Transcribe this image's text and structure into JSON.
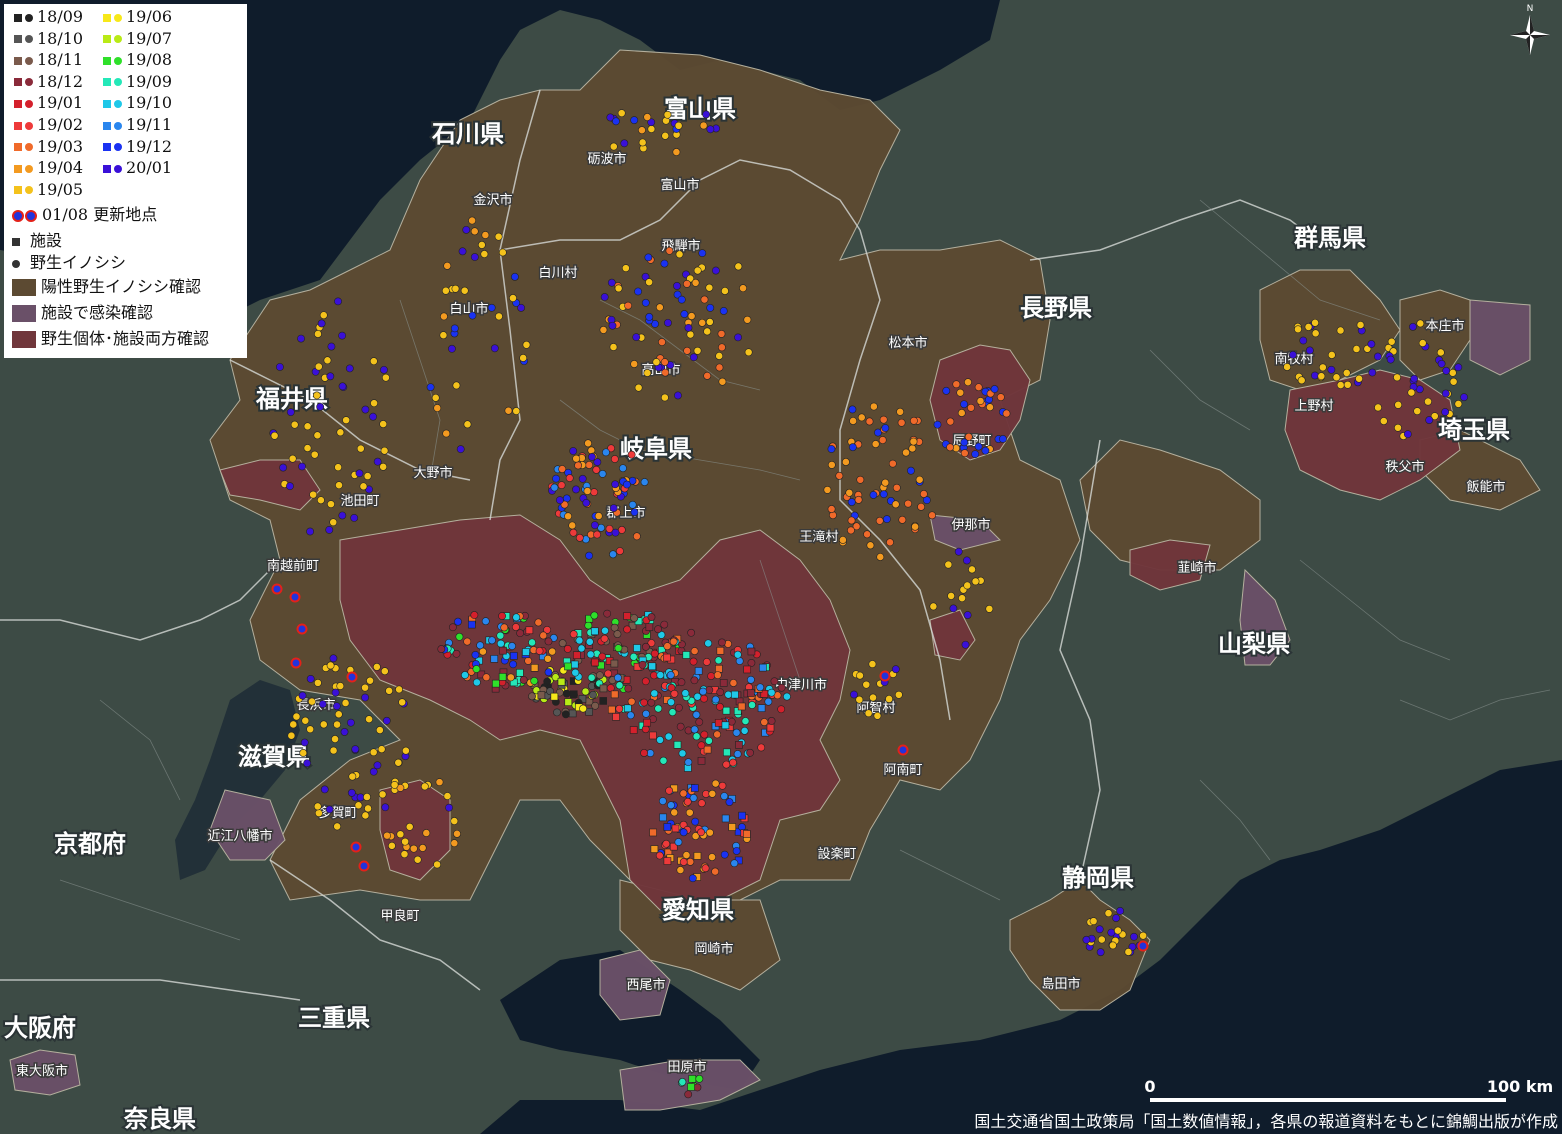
{
  "colors": {
    "land": "#3d4b45",
    "sea": "#0f1c2b",
    "border": "#9aa4a3",
    "positive_wild": "#5c4a32",
    "facility": "#6a5068",
    "both": "#70363b",
    "update_ring": "#e32119",
    "update_fill": "#2233dd"
  },
  "legend": {
    "months": [
      {
        "left": "18/09",
        "left_sq": "#222222",
        "left_dot": "#222222",
        "right": "19/06",
        "right_sq": "#f7e81a",
        "right_dot": "#f7e81a"
      },
      {
        "left": "18/10",
        "left_sq": "#555555",
        "left_dot": "#555555",
        "right": "19/07",
        "right_sq": "#b9ea16",
        "right_dot": "#b9ea16"
      },
      {
        "left": "18/11",
        "left_sq": "#7a5a4c",
        "left_dot": "#7a5a4c",
        "right": "19/08",
        "right_sq": "#2fe02a",
        "right_dot": "#2fe02a"
      },
      {
        "left": "18/12",
        "left_sq": "#8a2a3a",
        "left_dot": "#8a2a3a",
        "right": "19/09",
        "right_sq": "#24e8b8",
        "right_dot": "#24e8b8"
      },
      {
        "left": "19/01",
        "left_sq": "#d4202c",
        "left_dot": "#d4202c",
        "right": "19/10",
        "right_sq": "#1fc8e8",
        "right_dot": "#1fc8e8"
      },
      {
        "left": "19/02",
        "left_sq": "#ee3a3a",
        "left_dot": "#ee3a3a",
        "right": "19/11",
        "right_sq": "#2a86ee",
        "right_dot": "#2a86ee"
      },
      {
        "left": "19/03",
        "left_sq": "#f06a2a",
        "left_dot": "#f06a2a",
        "right": "19/12",
        "right_sq": "#1a32f2",
        "right_dot": "#1a32f2"
      },
      {
        "left": "19/04",
        "left_sq": "#f39a20",
        "left_dot": "#f39a20",
        "right": "20/01",
        "right_sq": "#3a10d8",
        "right_dot": "#3a10d8"
      },
      {
        "left": "19/05",
        "left_sq": "#f4c21c",
        "left_dot": "#f4c21c",
        "right": "",
        "right_sq": "",
        "right_dot": ""
      }
    ],
    "update_label": "01/08 更新地点",
    "facility_label": "施設",
    "wild_label": "野生イノシシ",
    "positive_wild_label": "陽性野生イノシシ確認",
    "facility_infection_label": "施設で感染確認",
    "both_label": "野生個体･施設両方確認"
  },
  "prefectures": [
    "富山県",
    "石川県",
    "福井県",
    "岐阜県",
    "長野県",
    "群馬県",
    "埼玉県",
    "山梨県",
    "滋賀県",
    "京都府",
    "愛知県",
    "静岡県",
    "三重県",
    "大阪府",
    "奈良県"
  ],
  "cities": [
    "砺波市",
    "富山市",
    "金沢市",
    "飛騨市",
    "白川村",
    "白山市",
    "松本市",
    "高山市",
    "南牧村",
    "本庄市",
    "上野村",
    "福井県大野市",
    "辰野町",
    "秩父市",
    "飯能市",
    "池田町",
    "郡上市",
    "伊那市",
    "王滝村",
    "南越前町",
    "韮崎市",
    "中津川市",
    "阿智村",
    "長浜市",
    "阿南町",
    "多賀町",
    "近江八幡市",
    "設楽町",
    "甲賀市",
    "岡崎市",
    "島田市",
    "西尾市",
    "田原市",
    "東大阪市"
  ],
  "city_labels": {
    "tonami": "砺波市",
    "toyama": "富山市",
    "kanazawa": "金沢市",
    "hida": "飛騨市",
    "shirakawa": "白川村",
    "hakusan": "白山市",
    "matsumoto": "松本市",
    "takayama": "高山市",
    "nanmoku": "南牧村",
    "honjo": "本庄市",
    "ueno": "上野村",
    "ono": "大野市",
    "tatsuno": "辰野町",
    "chichibu": "秩父市",
    "hanno": "飯能市",
    "ikeda": "池田町",
    "gujo": "郡上市",
    "ina": "伊那市",
    "otaki": "王滝村",
    "minamiechizen": "南越前町",
    "nirasaki": "韮崎市",
    "nakatsugawa": "中津川市",
    "achi": "阿智村",
    "nagahama": "長浜市",
    "anan": "阿南町",
    "taga": "多賀町",
    "omihachiman": "近江八幡市",
    "shitara": "設楽町",
    "kora": "甲良町",
    "okazaki": "岡崎市",
    "shimada": "島田市",
    "nishio": "西尾市",
    "tahara": "田原市",
    "higashiosaka": "東大阪市"
  },
  "scale": {
    "start": "0",
    "end": "100 km"
  },
  "credit": "国土交通省国土政策局「国土数値情報」，各県の報道資料をもとに錦鯛出版が作成",
  "north_label": "N"
}
